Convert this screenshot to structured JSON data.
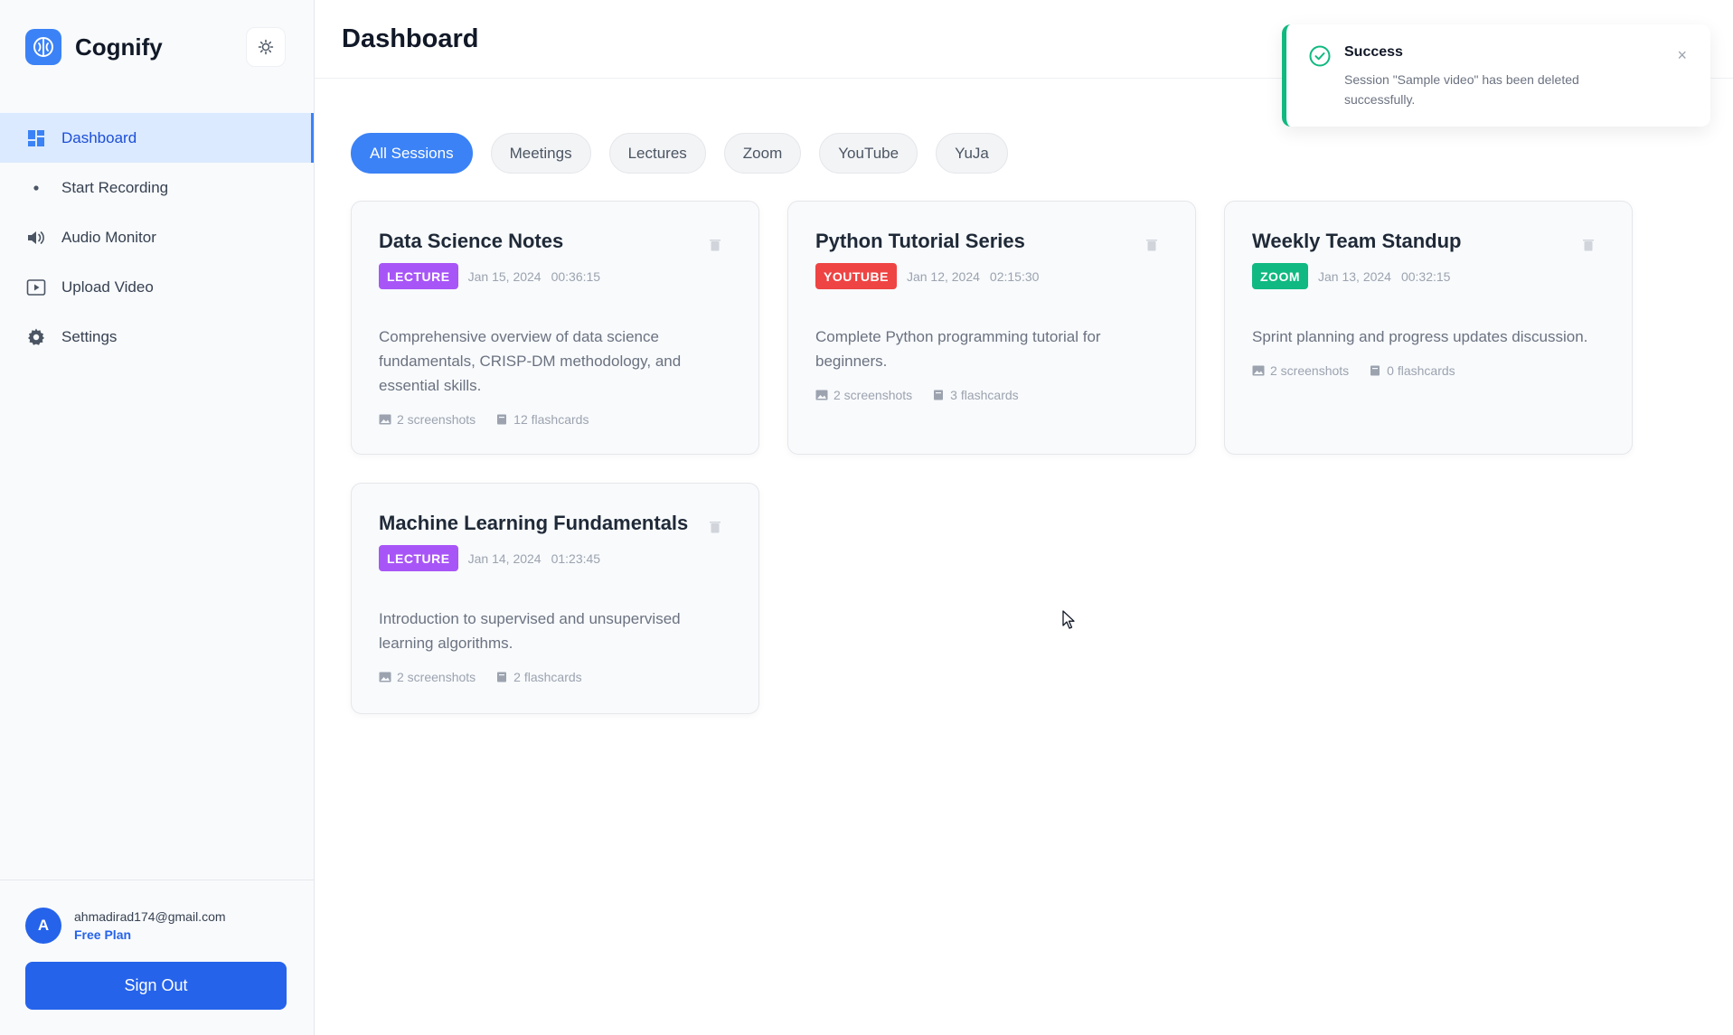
{
  "app": {
    "name": "Cognify",
    "theme_toggle_icon": "sun-icon",
    "brand_color": "#3b82f6"
  },
  "sidebar": {
    "items": [
      {
        "label": "Dashboard",
        "icon": "grid-icon",
        "active": true
      },
      {
        "label": "Start Recording",
        "icon": "dot-icon",
        "active": false
      },
      {
        "label": "Audio Monitor",
        "icon": "speaker-icon",
        "active": false
      },
      {
        "label": "Upload Video",
        "icon": "video-icon",
        "active": false
      },
      {
        "label": "Settings",
        "icon": "gear-icon",
        "active": false
      }
    ]
  },
  "user": {
    "initial": "A",
    "email": "ahmadirad174@gmail.com",
    "plan": "Free Plan"
  },
  "signout_label": "Sign Out",
  "header": {
    "title": "Dashboard"
  },
  "filters": {
    "tabs": [
      "All Sessions",
      "Meetings",
      "Lectures",
      "Zoom",
      "YouTube",
      "YuJa"
    ],
    "active": "All Sessions"
  },
  "sessions": [
    {
      "title": "Data Science Notes",
      "badge": "LECTURE",
      "badge_color": "#a855f7",
      "date": "Jan 15, 2024",
      "duration": "00:36:15",
      "description": "Comprehensive overview of data science fundamentals, CRISP-DM methodology, and essential skills.",
      "screenshots": "2 screenshots",
      "flashcards": "12 flashcards"
    },
    {
      "title": "Python Tutorial Series",
      "badge": "YOUTUBE",
      "badge_color": "#ef4444",
      "date": "Jan 12, 2024",
      "duration": "02:15:30",
      "description": "Complete Python programming tutorial for beginners.",
      "screenshots": "2 screenshots",
      "flashcards": "3 flashcards"
    },
    {
      "title": "Weekly Team Standup",
      "badge": "ZOOM",
      "badge_color": "#10b981",
      "date": "Jan 13, 2024",
      "duration": "00:32:15",
      "description": "Sprint planning and progress updates discussion.",
      "screenshots": "2 screenshots",
      "flashcards": "0 flashcards"
    },
    {
      "title": "Machine Learning Fundamentals",
      "badge": "LECTURE",
      "badge_color": "#a855f7",
      "date": "Jan 14, 2024",
      "duration": "01:23:45",
      "description": "Introduction to supervised and unsupervised learning algorithms.",
      "screenshots": "2 screenshots",
      "flashcards": "2 flashcards"
    }
  ],
  "toast": {
    "title": "Success",
    "message": "Session \"Sample video\" has been deleted successfully.",
    "close_symbol": "×",
    "accent_color": "#10b981"
  }
}
